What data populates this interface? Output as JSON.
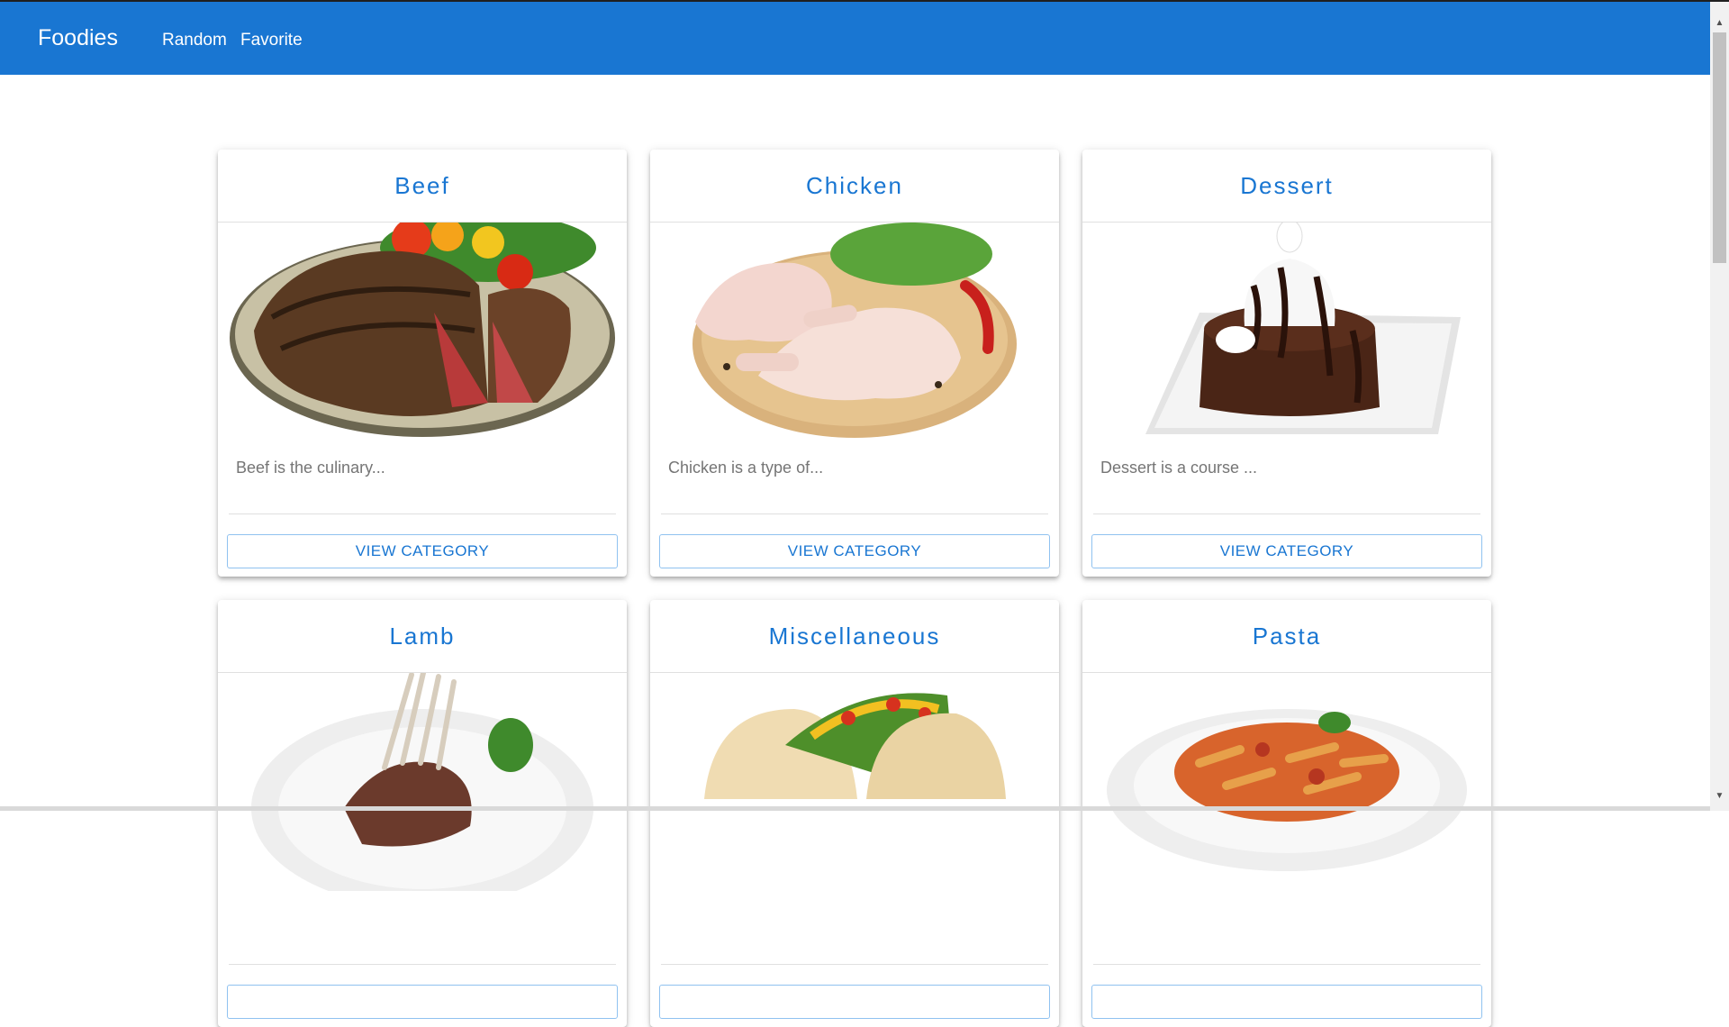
{
  "navbar": {
    "brand": "Foodies",
    "links": [
      "Random",
      "Favorite"
    ]
  },
  "categories": [
    {
      "title": "Beef",
      "description": "Beef is the culinary...",
      "button": "VIEW CATEGORY",
      "image_icon": "beef-steak-image"
    },
    {
      "title": "Chicken",
      "description": "Chicken is a type of...",
      "button": "VIEW CATEGORY",
      "image_icon": "chicken-legs-image"
    },
    {
      "title": "Dessert",
      "description": "Dessert is a course ...",
      "button": "VIEW CATEGORY",
      "image_icon": "chocolate-cake-image"
    },
    {
      "title": "Lamb",
      "description": "",
      "button": "",
      "image_icon": "lamb-rack-image"
    },
    {
      "title": "Miscellaneous",
      "description": "",
      "button": "",
      "image_icon": "tacos-image"
    },
    {
      "title": "Pasta",
      "description": "",
      "button": "",
      "image_icon": "penne-pasta-image"
    }
  ],
  "colors": {
    "primary": "#1976d2",
    "text_muted": "#757575"
  }
}
